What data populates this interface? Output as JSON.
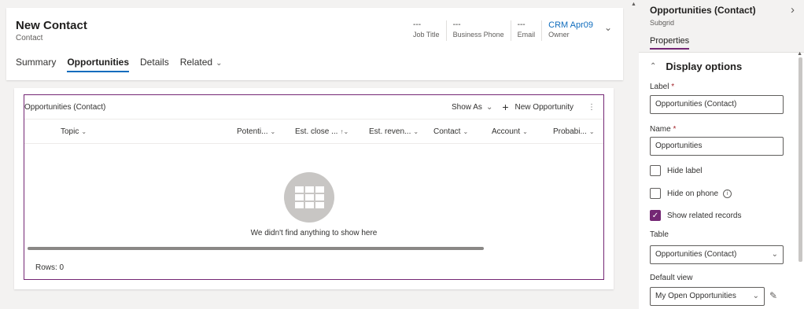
{
  "header": {
    "title": "New Contact",
    "subtitle": "Contact",
    "fields": [
      {
        "value": "---",
        "label": "Job Title"
      },
      {
        "value": "---",
        "label": "Business Phone"
      },
      {
        "value": "---",
        "label": "Email"
      },
      {
        "value": "CRM Apr09",
        "label": "Owner"
      }
    ]
  },
  "tabs": [
    {
      "label": "Summary"
    },
    {
      "label": "Opportunities"
    },
    {
      "label": "Details"
    },
    {
      "label": "Related"
    }
  ],
  "subgrid": {
    "title": "Opportunities (Contact)",
    "show_as": "Show As",
    "new_label": "New Opportunity",
    "columns": [
      "Topic",
      "Potenti...",
      "Est. close ...",
      "Est. reven...",
      "Contact",
      "Account",
      "Probabi..."
    ],
    "empty_message": "We didn't find anything to show here",
    "rows_label": "Rows: 0"
  },
  "pane": {
    "title": "Opportunities (Contact)",
    "subtitle": "Subgrid",
    "tab": "Properties",
    "section": "Display options",
    "label_caption": "Label",
    "label_value": "Opportunities (Contact)",
    "name_caption": "Name",
    "name_value": "Opportunities",
    "required_mark": "*",
    "hide_label": "Hide label",
    "hide_on_phone": "Hide on phone",
    "show_related": "Show related records",
    "table_caption": "Table",
    "table_value": "Opportunities (Contact)",
    "default_view_caption": "Default view",
    "default_view_value": "My Open Opportunities"
  },
  "colors": {
    "accent": "#742774",
    "link": "#0f6cbd"
  }
}
